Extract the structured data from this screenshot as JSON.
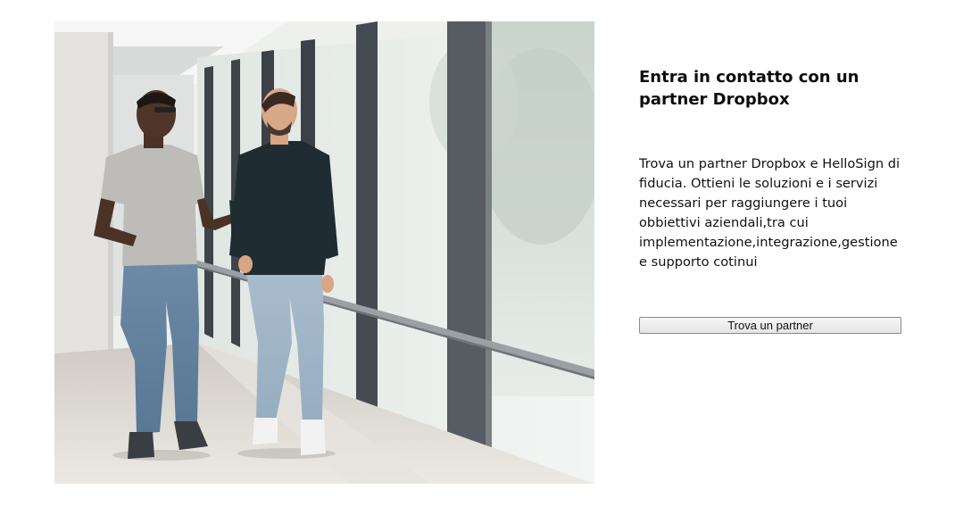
{
  "hero": {
    "photo_icon": "two-people-walking-photo"
  },
  "content": {
    "title": "Entra in contatto con un partner Dropbox",
    "description": "Trova un partner Dropbox e HelloSign di fiducia. Ottieni le soluzioni e i servizi necessari per raggiungere i tuoi obbiettivi aziendali,tra cui implementazione,integrazione,gestione e supporto cotinui",
    "cta_label": "Trova un partner"
  },
  "colors": {
    "button_border": "#8a8a8a",
    "button_bg": "#ececec",
    "text": "#0d0d0d"
  }
}
